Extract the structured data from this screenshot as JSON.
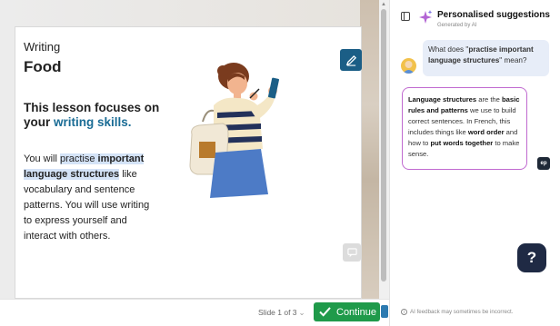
{
  "slide": {
    "subject": "Writing",
    "title": "Food",
    "focus_prefix": "This lesson focuses on your ",
    "focus_highlight": "writing skills.",
    "body_pre": "You will ",
    "body_sel_plain": "practise ",
    "body_sel_bold1": "important",
    "body_sel_bold2": "language structures",
    "body_post": " like vocabulary and sentence patterns. You will use writing to express yourself and interact with others."
  },
  "navigation": {
    "slide_counter": "Slide 1 of 3",
    "continue_label": "Continue"
  },
  "panel": {
    "title": "Personalised suggestions",
    "subtitle": "Generated by AI",
    "user_q_pre": "What does \"",
    "user_q_bold": "practise important language structures",
    "user_q_post": "\" mean?",
    "ai_b1": "Language structures",
    "ai_t1": " are the ",
    "ai_b2": "basic rules and patterns",
    "ai_t2": " we use to build correct sentences. In French, this includes things like ",
    "ai_b3": "word order",
    "ai_t3": " and how to ",
    "ai_b4": "put words together",
    "ai_t4": " to make sense.",
    "ai_badge": "ep",
    "help_label": "?",
    "disclaimer": "AI feedback may sometimes be incorrect."
  },
  "icons": {
    "pen": "pen-icon",
    "chat": "chat-icon",
    "check": "check-icon",
    "sparkle": "sparkle-icon",
    "sidebar": "sidebar-toggle-icon"
  },
  "colors": {
    "accent_blue": "#1a6c95",
    "continue_green": "#1f9a4a",
    "ai_border": "#c06ad0",
    "help_bg": "#1f2a44"
  }
}
